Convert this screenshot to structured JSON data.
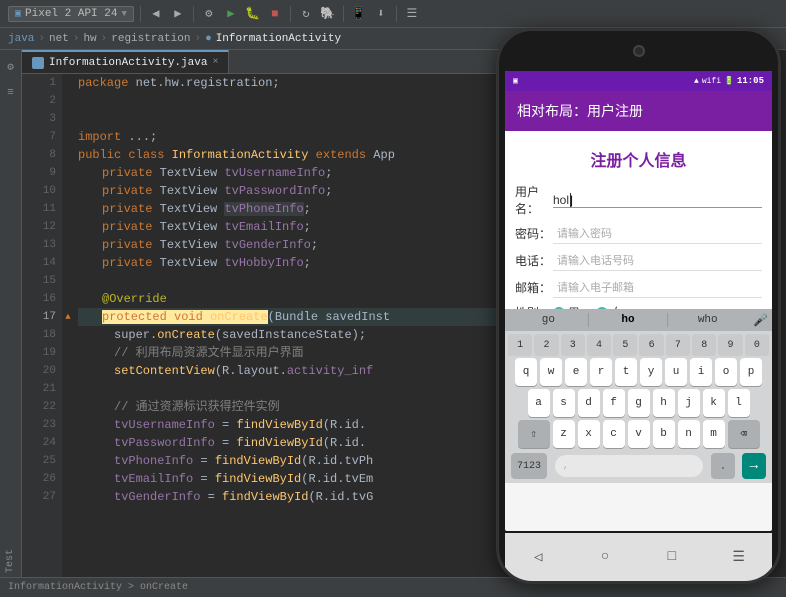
{
  "toolbar": {
    "device": "Pixel 2 API 24",
    "api": "24"
  },
  "breadcrumb": {
    "items": [
      "java",
      "net",
      "hw",
      "registration",
      "InformationActivity"
    ]
  },
  "tabs": [
    {
      "label": "InformationActivity.java",
      "active": true
    }
  ],
  "code": {
    "lines": [
      {
        "num": 1,
        "text": "package net.hw.registration;"
      },
      {
        "num": 2,
        "text": ""
      },
      {
        "num": 3,
        "text": ""
      },
      {
        "num": 7,
        "text": "import ...;"
      },
      {
        "num": 8,
        "text": "public class InformationActivity extends App"
      },
      {
        "num": 9,
        "text": "    private TextView tvUsernameInfo;"
      },
      {
        "num": 10,
        "text": "    private TextView tvPasswordInfo;"
      },
      {
        "num": 11,
        "text": "    private TextView tvPhoneInfo;"
      },
      {
        "num": 12,
        "text": "    private TextView tvEmailInfo;"
      },
      {
        "num": 13,
        "text": "    private TextView tvGenderInfo;"
      },
      {
        "num": 14,
        "text": "    private TextView tvHobbyInfo;"
      },
      {
        "num": 15,
        "text": ""
      },
      {
        "num": 16,
        "text": "    @Override"
      },
      {
        "num": 17,
        "text": "    protected void onCreate(Bundle savedInst"
      },
      {
        "num": 18,
        "text": "        super.onCreate(savedInstanceState);"
      },
      {
        "num": 19,
        "text": "        // 利用布局资源文件显示用户界面"
      },
      {
        "num": 20,
        "text": "        setContentView(R.layout.activity_inf"
      },
      {
        "num": 21,
        "text": ""
      },
      {
        "num": 22,
        "text": "        // 通过资源标识获得控件实例"
      },
      {
        "num": 23,
        "text": "        tvUsernameInfo = findViewById(R.id."
      },
      {
        "num": 24,
        "text": "        tvPasswordInfo = findViewById(R.id."
      },
      {
        "num": 25,
        "text": "        tvPhoneInfo = findViewById(R.id.tvPh"
      },
      {
        "num": 26,
        "text": "        tvEmailInfo = findViewById(R.id.tvEm"
      },
      {
        "num": 27,
        "text": "        tvGenderInfo = findViewById(R.id.tvG"
      }
    ]
  },
  "phone": {
    "time": "11:05",
    "app_bar_title": "相对布局：用户注册",
    "content_title": "注册个人信息",
    "fields": [
      {
        "label": "用户名：",
        "placeholder": "",
        "value": "hol",
        "has_cursor": true
      },
      {
        "label": "密码：",
        "placeholder": "请输入密码",
        "value": ""
      },
      {
        "label": "电话：",
        "placeholder": "请输入电话号码",
        "value": ""
      },
      {
        "label": "邮箱：",
        "placeholder": "请输入电子邮箱",
        "value": ""
      }
    ],
    "gender_label": "性别：",
    "gender_options": [
      "男",
      "女"
    ],
    "gender_selected": "男",
    "keyboard": {
      "suggestions": [
        "go",
        "ho",
        "who"
      ],
      "rows": [
        [
          "q",
          "w",
          "e",
          "r",
          "t",
          "y",
          "u",
          "i",
          "o",
          "p"
        ],
        [
          "a",
          "s",
          "d",
          "f",
          "g",
          "h",
          "j",
          "k",
          "l"
        ],
        [
          "↑",
          "z",
          "x",
          "c",
          "v",
          "b",
          "n",
          "m",
          "⌫"
        ]
      ],
      "bottom_num": "7123",
      "bottom_sep": ",",
      "bottom_action": "→"
    }
  },
  "status_bar": {
    "text": "InformationActivity > onCreate"
  },
  "left_panel": {
    "items": [
      "Test"
    ]
  }
}
